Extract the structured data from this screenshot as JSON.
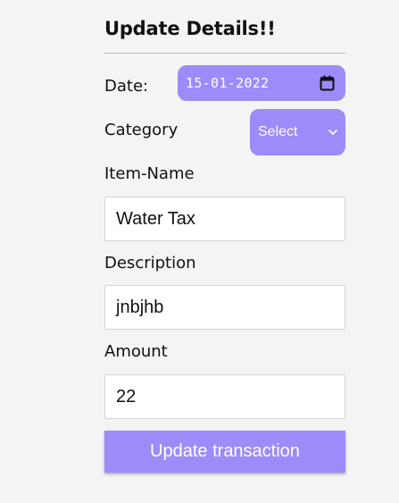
{
  "form": {
    "title": "Update Details!!",
    "date": {
      "label": "Date:",
      "value": "15-01-2022"
    },
    "category": {
      "label": "Category",
      "selected": "Select"
    },
    "item_name": {
      "label": "Item-Name",
      "value": "Water Tax"
    },
    "description": {
      "label": "Description",
      "value": "jnbjhb"
    },
    "amount": {
      "label": "Amount",
      "value": "22"
    },
    "submit_label": "Update transaction"
  },
  "icons": {
    "date_picker": "calendar-icon",
    "select_arrow": "chevron-down-icon"
  },
  "colors": {
    "accent": "#9d8bfa",
    "background": "#f4f4f4",
    "input_background": "#ffffff",
    "text": "#111111"
  }
}
